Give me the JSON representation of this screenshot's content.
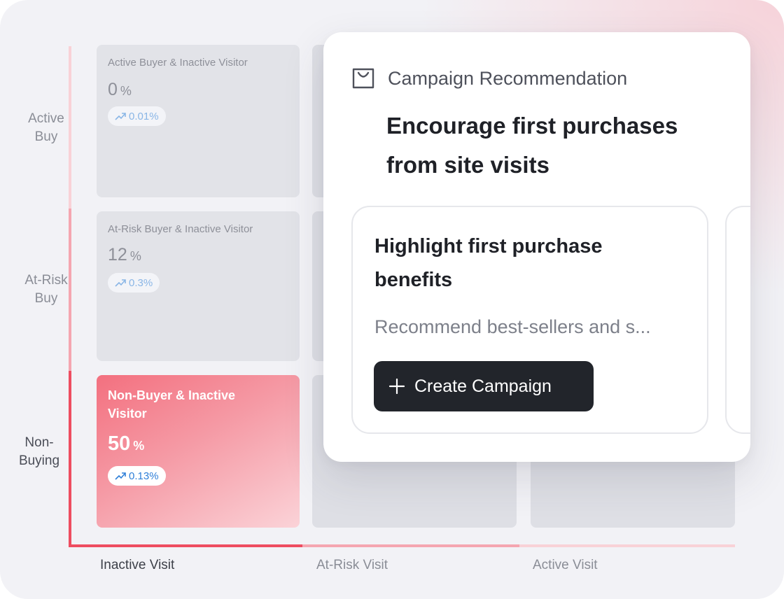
{
  "y_axis": {
    "labels": [
      "Active\nBuy",
      "At-Risk\nBuy",
      "Non-\nBuying"
    ]
  },
  "x_axis": {
    "labels": [
      "Inactive Visit",
      "At-Risk Visit",
      "Active Visit"
    ]
  },
  "segments": [
    {
      "title": "Active Buyer & Inactive Visitor",
      "value": "0",
      "unit": "%",
      "trend": "0.01%"
    },
    {
      "title": "At-Risk Buyer & Inactive Visitor",
      "value": "12",
      "unit": "%",
      "trend": "0.3%"
    },
    {
      "title": "Non-Buyer & Inactive Visitor",
      "value": "50",
      "unit": "%",
      "trend": "0.13%"
    }
  ],
  "card": {
    "header_label": "Campaign Recommendation",
    "title": "Encourage first purchases from site visits",
    "recommendation": {
      "title": "Highlight first purchase benefits",
      "description": "Recommend best-sellers and s...",
      "button_label": "Create Campaign"
    }
  },
  "colors": {
    "accent_red": "#ee4d60",
    "button_dark": "#22252b",
    "trend_blue": "#2f7fd8"
  }
}
